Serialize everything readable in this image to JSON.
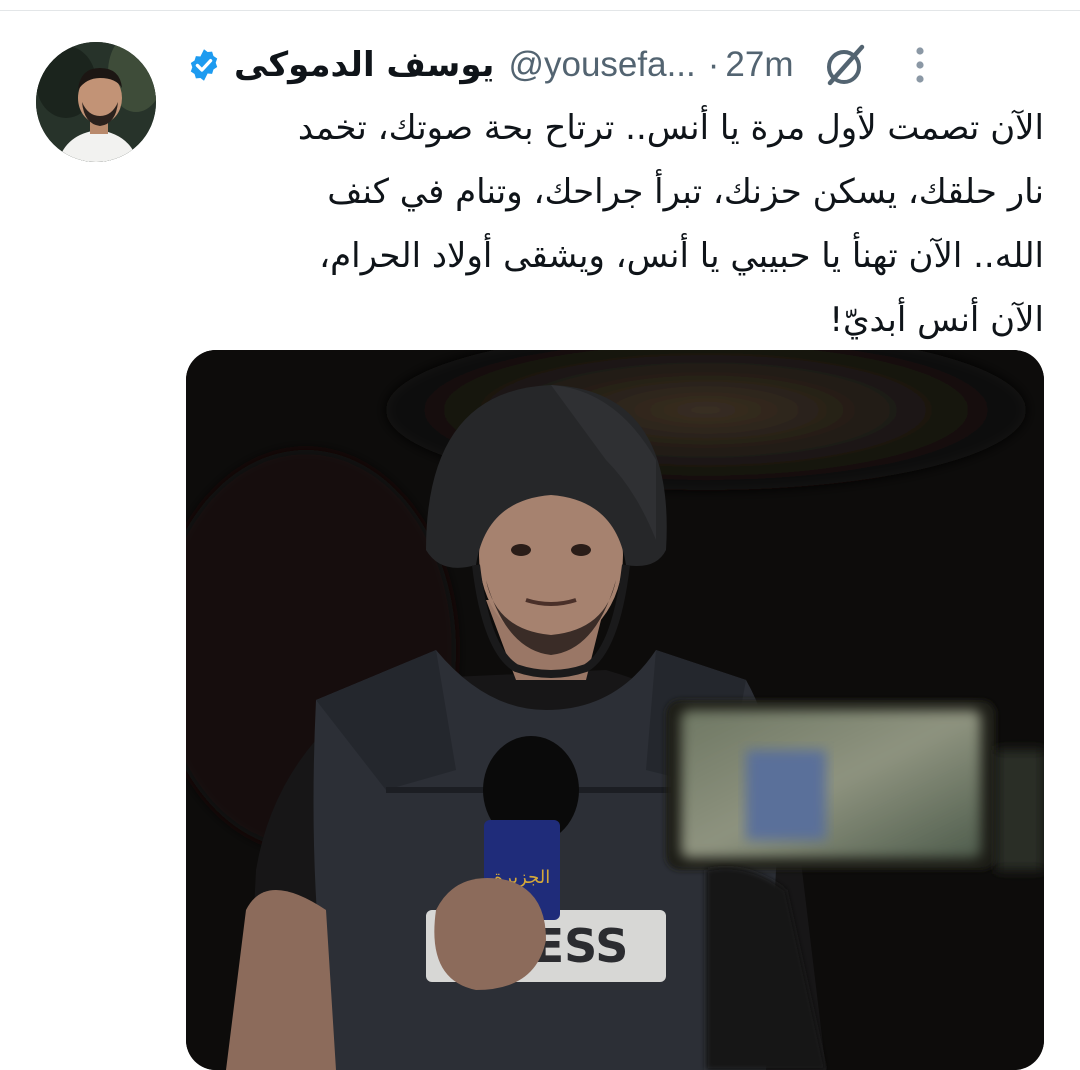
{
  "tweet": {
    "author": {
      "display_name": "يوسف الدموكى",
      "handle": "@yousefa...",
      "verified": true,
      "avatar_icon": "profile-photo"
    },
    "separator": "·",
    "timestamp": "27m",
    "text_lines": [
      "الآن تصمت لأول مرة يا أنس.. ترتاح بحة صوتك، تخمد",
      "نار حلقك، يسكن حزنك، تبرأ جراحك، وتنام في كنف",
      "الله.. الآن تهنأ يا حبيبي يا أنس، ويشقى أولاد الحرام،",
      "الآن أنس أبديّ!"
    ],
    "icons": {
      "verified": "verified-badge-icon",
      "grok": "grok-icon",
      "more": "more-vertical-icon"
    },
    "media": {
      "type": "photo",
      "vest_text": "PRESS",
      "mic_logo": "الجزيرة"
    }
  },
  "colors": {
    "text_primary": "#0f1419",
    "text_secondary": "#536471",
    "verified_blue": "#1d9bf0",
    "background": "#ffffff"
  }
}
